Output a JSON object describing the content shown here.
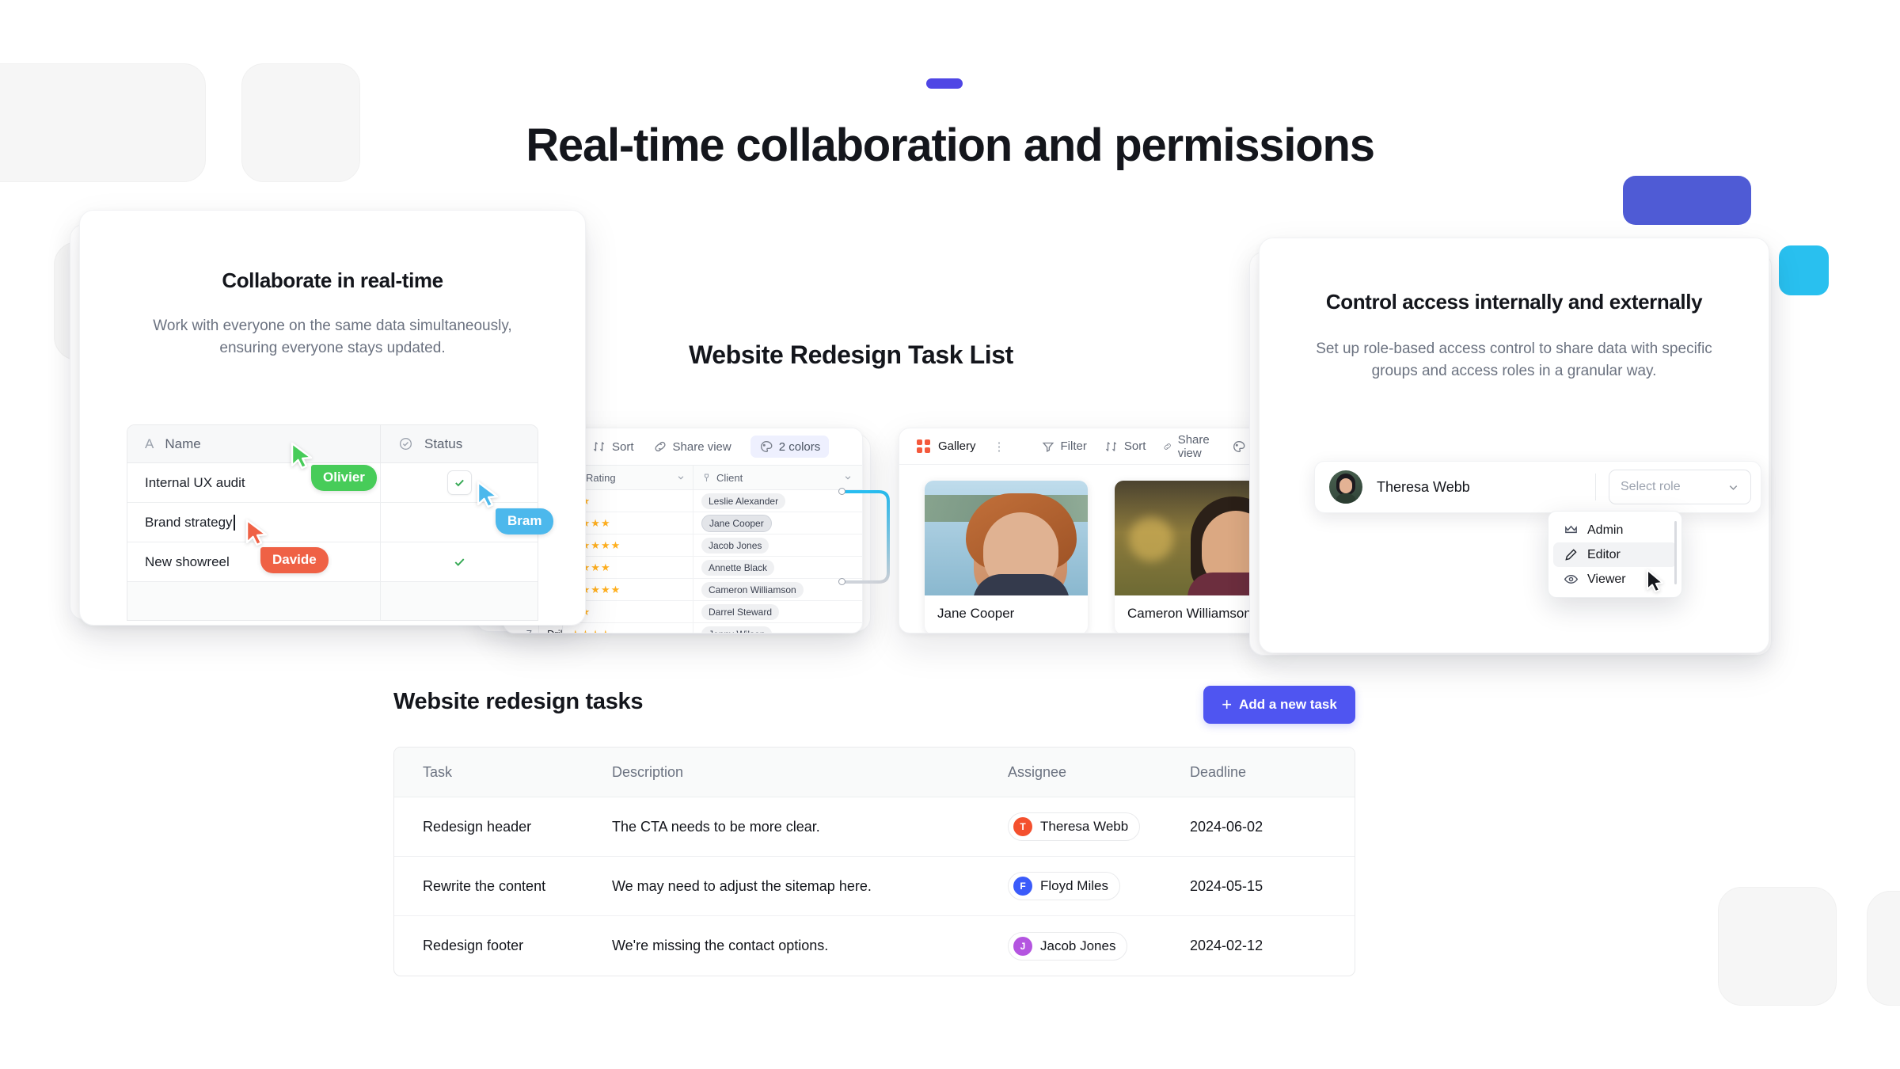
{
  "hero": {
    "title": "Real-time collaboration and permissions"
  },
  "collab_card": {
    "title": "Collaborate in real-time",
    "subtitle": "Work with everyone on the same data simultaneously, ensuring everyone stays updated.",
    "table": {
      "columns": [
        "Name",
        "Status"
      ],
      "rows": [
        {
          "name": "Internal UX audit",
          "status": "checked-box"
        },
        {
          "name": "Brand strategy",
          "status": ""
        },
        {
          "name": "New showreel",
          "status": "check"
        }
      ]
    },
    "cursors": [
      {
        "label": "Olivier",
        "color": "#47cc59"
      },
      {
        "label": "Bram",
        "color": "#4cb8ec"
      },
      {
        "label": "Davide",
        "color": "#ef6145"
      }
    ]
  },
  "mid_heading": "Website Redesign Task List",
  "grid_card": {
    "toolbar": [
      {
        "label": "Sort",
        "icon": "sort-icon"
      },
      {
        "label": "Share view",
        "icon": "link-icon"
      },
      {
        "label": "2 colors",
        "icon": "palette-icon",
        "highlight": true
      }
    ],
    "columns": [
      "Rating",
      "Client"
    ],
    "rows": [
      {
        "stars": 2,
        "client": "Leslie Alexander",
        "selected": false
      },
      {
        "stars": 4,
        "client": "Jane Cooper",
        "selected": true
      },
      {
        "stars": 5,
        "client": "Jacob Jones",
        "selected": false
      },
      {
        "stars": 4,
        "client": "Annette Black",
        "selected": false
      },
      {
        "stars": 5,
        "client": "Cameron Williamson",
        "selected": false
      },
      {
        "stars": 2,
        "client": "Darrel Steward",
        "selected": false
      },
      {
        "stars": 4,
        "client": "Jenny Wilson",
        "selected": false
      }
    ],
    "last_row": {
      "num": "7",
      "name": "Dribbble shots"
    }
  },
  "gallery_card": {
    "view_name": "Gallery",
    "toolbar": [
      "Filter",
      "Sort",
      "Share view",
      "Color"
    ],
    "items": [
      {
        "name": "Jane Cooper"
      },
      {
        "name": "Cameron Williamson"
      }
    ]
  },
  "access_card": {
    "title": "Control access internally and externally",
    "subtitle": "Set up role-based access control to share data with specific groups and access roles in a granular way.",
    "member": {
      "name": "Theresa Webb"
    },
    "role_select_placeholder": "Select role",
    "roles": [
      {
        "label": "Admin",
        "icon": "crown-icon",
        "active": false
      },
      {
        "label": "Editor",
        "icon": "pencil-icon",
        "active": true
      },
      {
        "label": "Viewer",
        "icon": "eye-icon",
        "active": false
      }
    ]
  },
  "tasks_section": {
    "title": "Website redesign tasks",
    "add_button": "Add a new task",
    "columns": [
      "Task",
      "Description",
      "Assignee",
      "Deadline"
    ],
    "rows": [
      {
        "task": "Redesign header",
        "description": "The CTA needs to be more clear.",
        "assignee": "Theresa Webb",
        "initial": "T",
        "avatar_color": "#f4502e",
        "deadline": "2024-06-02"
      },
      {
        "task": "Rewrite the content",
        "description": "We may need to adjust the sitemap here.",
        "assignee": "Floyd Miles",
        "initial": "F",
        "avatar_color": "#3b5bfa",
        "deadline": "2024-05-15"
      },
      {
        "task": "Redesign footer",
        "description": "We're missing the contact options.",
        "assignee": "Jacob Jones",
        "initial": "J",
        "avatar_color": "#b455e0",
        "deadline": "2024-02-12"
      }
    ]
  },
  "colors": {
    "accent_indigo": "#4f46e5",
    "button_indigo": "#4f55f1",
    "deco_indigo": "#4f5bd5",
    "deco_cyan": "#29c0ef",
    "star_gold": "#ffb020",
    "check_green": "#33a852"
  }
}
